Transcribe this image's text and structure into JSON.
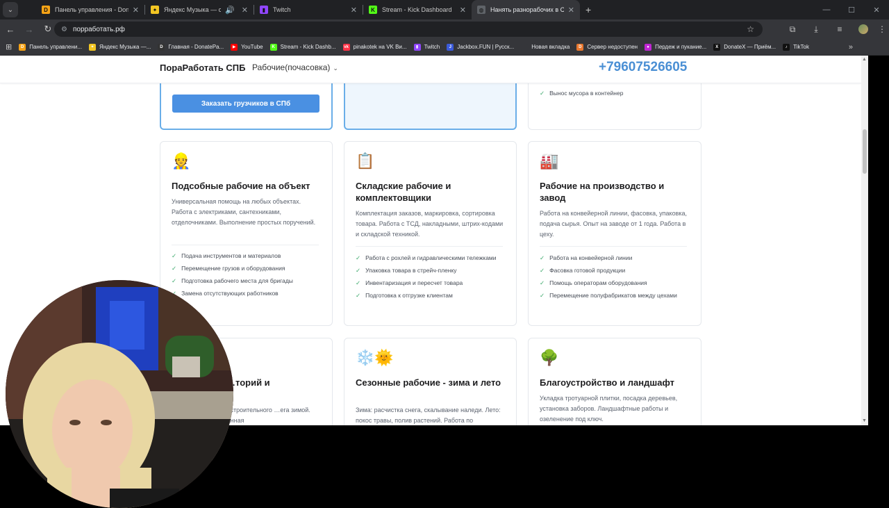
{
  "browser": {
    "tabs": [
      {
        "title": "Панель управления - Donation",
        "color": "#f6a316",
        "glyph": "D"
      },
      {
        "title": "Яндекс Музыка — собирае",
        "color": "#f3c623",
        "glyph": "✦"
      },
      {
        "title": "Twitch",
        "color": "#9146ff",
        "glyph": "▮"
      },
      {
        "title": "Stream - Kick Dashboard",
        "color": "#53fc18",
        "glyph": "K"
      },
      {
        "title": "Нанять разнорабочих в СПб с",
        "color": "#5f6368",
        "glyph": "◍"
      }
    ],
    "new_tab": "+",
    "url": "порработать.рф",
    "bookmarks": [
      {
        "label": "Панель управлени...",
        "color": "#f6a316",
        "glyph": "D"
      },
      {
        "label": "Яндекс Музыка —...",
        "color": "#f3c623",
        "glyph": "✦"
      },
      {
        "label": "Главная - DonatePa...",
        "color": "#333333",
        "glyph": "D"
      },
      {
        "label": "YouTube",
        "color": "#ff0000",
        "glyph": "▶"
      },
      {
        "label": "Stream - Kick Dashb...",
        "color": "#53fc18",
        "glyph": "K"
      },
      {
        "label": "pinakotek на VK Ви...",
        "color": "#ff3347",
        "glyph": "vk"
      },
      {
        "label": "Twitch",
        "color": "#9146ff",
        "glyph": "▮"
      },
      {
        "label": "Jackbox.FUN | Русск...",
        "color": "#3b5bdb",
        "glyph": "J"
      },
      {
        "label": "Новая вкладка",
        "color": "#35363a",
        "glyph": ""
      },
      {
        "label": "Сервер недоступен",
        "color": "#e8772e",
        "glyph": "D"
      },
      {
        "label": "Пердеж и пукание...",
        "color": "#c026d3",
        "glyph": "●"
      },
      {
        "label": "DonateX — Приём...",
        "color": "#111111",
        "glyph": "X"
      },
      {
        "label": "TikTok",
        "color": "#111111",
        "glyph": "♪"
      }
    ]
  },
  "site": {
    "logo": "ПораРаботать СПБ",
    "menu": "Рабочие(почасовка)",
    "phone": "+79607526605",
    "order_button": "Заказать грузчиков в СПб",
    "top_right_feature": "Вынос мусора в контейнер",
    "cards": [
      {
        "emoji": "👷",
        "title": "Подсобные рабочие на объект",
        "desc": "Универсальная помощь на любых объектах. Работа с электриками, сантехниками, отделочниками. Выполнение простых поручений.",
        "features": [
          "Подача инструментов и материалов",
          "Перемещение грузов и оборудования",
          "Подготовка рабочего места для бригады",
          "Замена отсутствующих работников"
        ]
      },
      {
        "emoji": "📋",
        "title": "Складские рабочие и комплектовщики",
        "desc": "Комплектация заказов, маркировка, сортировка товара. Работа с ТСД, накладными, штрих-кодами и складской техникой.",
        "features": [
          "Работа с рохлей и гидравлическими тележками",
          "Упаковка товара в стрейч-пленку",
          "Инвентаризация и пересчет товара",
          "Подготовка к отгрузке клиентам"
        ]
      },
      {
        "emoji": "🏭",
        "title": "Рабочие на производство и завод",
        "desc": "Работа на конвейерной линии, фасовка, упаковка, подача сырья. Опыт на заводе от 1 года. Работа в цеху.",
        "features": [
          "Работа на конвейерной линии",
          "Фасовка готовой продукции",
          "Помощь операторам оборудования",
          "Перемещение полуфабрикатов между цехами"
        ]
      },
      {
        "emoji": "",
        "title": "…торий и",
        "desc": "…онта, вывоз строительного …ега зимой. Механизированная",
        "features": []
      },
      {
        "emoji": "❄️🌞",
        "title": "Сезонные рабочие - зима и лето",
        "desc": "Зима: расчистка снега, скалывание наледи. Лето: покос травы, полив растений. Работа по",
        "features": []
      },
      {
        "emoji": "🌳",
        "title": "Благоустройство и ландшафт",
        "desc": "Укладка тротуарной плитки, посадка деревьев, установка заборов. Ландшафтные работы и озеленение под ключ.",
        "features": []
      }
    ]
  },
  "check_glyph": "✓"
}
